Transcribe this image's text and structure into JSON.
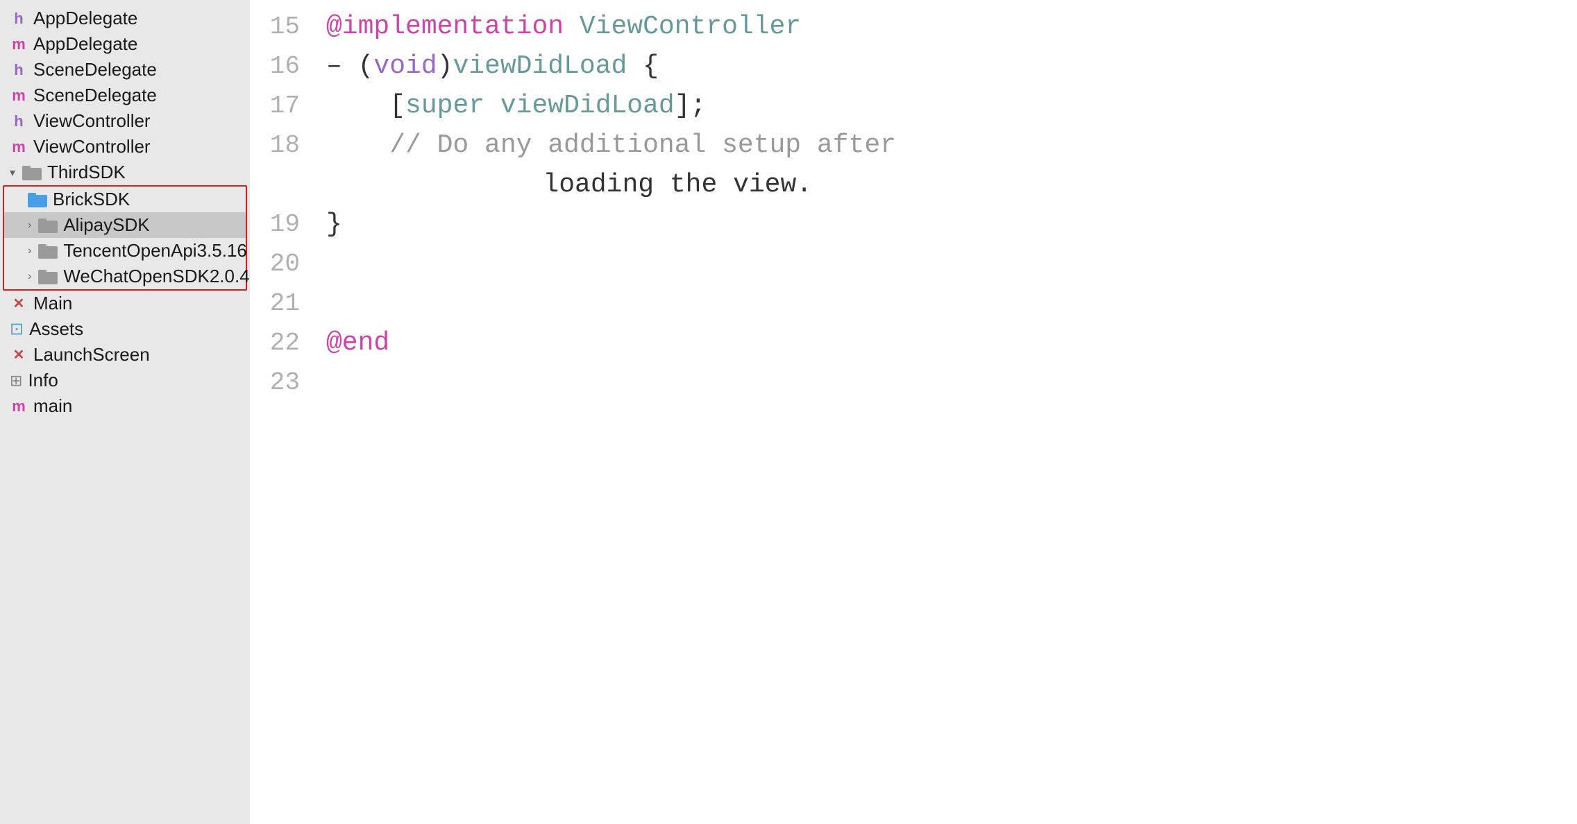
{
  "sidebar": {
    "items": [
      {
        "id": "app-delegate-h",
        "label": "AppDelegate",
        "indent": 0,
        "icon_type": "h",
        "icon_color": "purple",
        "selected": false
      },
      {
        "id": "app-delegate-m",
        "label": "AppDelegate",
        "indent": 0,
        "icon_type": "m",
        "icon_color": "pink",
        "selected": false
      },
      {
        "id": "scene-delegate-h",
        "label": "SceneDelegate",
        "indent": 0,
        "icon_type": "h",
        "icon_color": "purple",
        "selected": false
      },
      {
        "id": "scene-delegate-m",
        "label": "SceneDelegate",
        "indent": 0,
        "icon_type": "m",
        "icon_color": "pink",
        "selected": false
      },
      {
        "id": "view-controller-h",
        "label": "ViewController",
        "indent": 0,
        "icon_type": "h",
        "icon_color": "purple",
        "selected": false
      },
      {
        "id": "view-controller-m",
        "label": "ViewController",
        "indent": 0,
        "icon_type": "m",
        "icon_color": "pink",
        "selected": false
      },
      {
        "id": "thirdsdk",
        "label": "ThirdSDK",
        "indent": 0,
        "icon_type": "folder_gray",
        "chevron": "▾",
        "selected": false
      },
      {
        "id": "bricksdk",
        "label": "BrickSDK",
        "indent": 1,
        "icon_type": "folder_blue",
        "selected": false,
        "in_red_box": true
      },
      {
        "id": "alipaysdk",
        "label": "AlipaySDK",
        "indent": 1,
        "icon_type": "folder_gray",
        "chevron": "›",
        "selected": true,
        "in_red_box": true
      },
      {
        "id": "tencent",
        "label": "TencentOpenApi3.5.16",
        "indent": 1,
        "icon_type": "folder_gray",
        "chevron": "›",
        "selected": false,
        "in_red_box": true
      },
      {
        "id": "wechat",
        "label": "WeChatOpenSDK2.0.4",
        "indent": 1,
        "icon_type": "folder_gray",
        "chevron": "›",
        "selected": false,
        "in_red_box": true
      },
      {
        "id": "main",
        "label": "Main",
        "indent": 0,
        "icon_type": "x",
        "icon_color": "red",
        "selected": false
      },
      {
        "id": "assets",
        "label": "Assets",
        "indent": 0,
        "icon_type": "assets",
        "selected": false
      },
      {
        "id": "launchscreen",
        "label": "LaunchScreen",
        "indent": 0,
        "icon_type": "x",
        "icon_color": "red",
        "selected": false
      },
      {
        "id": "info",
        "label": "Info",
        "indent": 0,
        "icon_type": "grid",
        "selected": false
      },
      {
        "id": "main-m",
        "label": "main",
        "indent": 0,
        "icon_type": "m",
        "icon_color": "pink",
        "selected": false
      }
    ]
  },
  "editor": {
    "lines": [
      {
        "number": 15,
        "content": "@implementation ViewController",
        "type": "partial_top"
      },
      {
        "number": 16,
        "content": "- (void)viewDidLoad {"
      },
      {
        "number": 17,
        "content": "    [super viewDidLoad];"
      },
      {
        "number": 18,
        "content": "    // Do any additional setup after",
        "continuation": "        loading the view."
      },
      {
        "number": 19,
        "content": "}"
      },
      {
        "number": 20,
        "content": ""
      },
      {
        "number": 21,
        "content": ""
      },
      {
        "number": 22,
        "content": "@end"
      },
      {
        "number": 23,
        "content": ""
      }
    ]
  },
  "icons": {
    "h_letter": "h",
    "m_letter": "m",
    "x_letter": "✕",
    "grid_symbol": "⊞"
  }
}
